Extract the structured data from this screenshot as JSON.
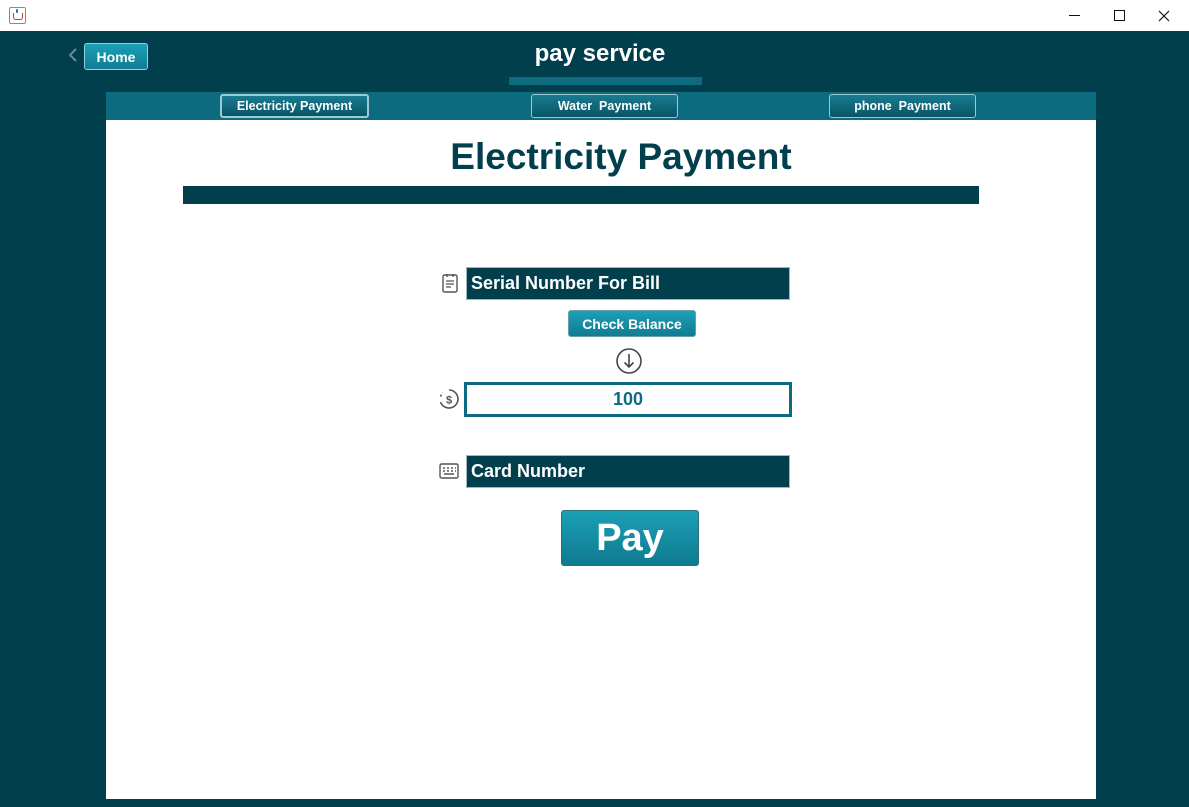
{
  "window": {
    "app_icon": "java-cup-icon",
    "controls": [
      "minimize-icon",
      "maximize-icon",
      "close-icon"
    ]
  },
  "header": {
    "back_icon": "chevron-left-icon",
    "home_label": "Home",
    "title": "pay service"
  },
  "tabs": [
    {
      "label": "Electricity Payment",
      "selected": true
    },
    {
      "label": "Water  Payment",
      "selected": false
    },
    {
      "label": "phone  Payment",
      "selected": false
    }
  ],
  "main": {
    "title": "Electricity Payment",
    "serial": {
      "icon": "bill-icon",
      "placeholder": "Serial Number For Bill",
      "value": ""
    },
    "check_balance_label": "Check Balance",
    "arrow_icon": "arrow-down-circle-icon",
    "balance": {
      "icon": "dollar-history-icon",
      "value": "100"
    },
    "card": {
      "icon": "keypad-icon",
      "placeholder": "Card Number",
      "value": ""
    },
    "pay_label": "Pay"
  },
  "colors": {
    "background": "#023f4d",
    "accent": "#0d6b80",
    "button": "#1598ad",
    "panel": "#ffffff"
  }
}
